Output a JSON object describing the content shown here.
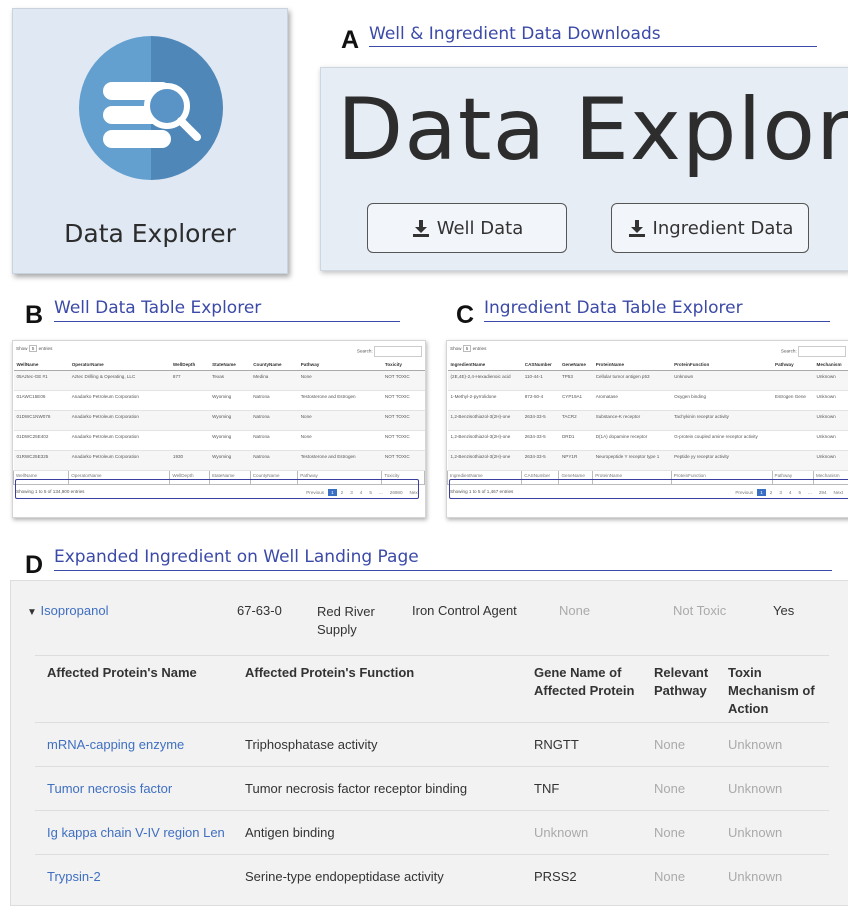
{
  "logo": {
    "icon": "database-search-icon",
    "label": "Data Explorer",
    "colors": {
      "light": "#64a0cf",
      "dark": "#4f87b8"
    }
  },
  "sections": {
    "a": {
      "letter": "A",
      "title": "Well & Ingredient Data Downloads"
    },
    "b": {
      "letter": "B",
      "title": "Well Data Table Explorer"
    },
    "c": {
      "letter": "C",
      "title": "Ingredient Data Table Explorer"
    },
    "d": {
      "letter": "D",
      "title": "Expanded Ingredient on Well Landing Page"
    }
  },
  "explorer": {
    "title": "Data Explorer",
    "well_button": "Well Data",
    "ingredient_button": "Ingredient Data"
  },
  "well_table": {
    "show_prefix": "Show",
    "show_value": "5",
    "show_suffix": "entries",
    "search_label": "Search:",
    "headers": [
      "WellName",
      "OperatorName",
      "WellDepth",
      "StateName",
      "CountyName",
      "Pathway",
      "Toxicity"
    ],
    "rows": [
      [
        "05Aztec-GE #1",
        "Aztec Drilling & Operating, LLC",
        "877",
        "Texas",
        "Medina",
        "None",
        "NOT TOXIC"
      ],
      [
        "01AWC15E06",
        "Anadarko Petroleum Corporation",
        "",
        "Wyoming",
        "Natrona",
        "Testosterone and Estrogen",
        "NOT TOXIC"
      ],
      [
        "01DWC1NW076",
        "Anadarko Petroleum Corporation",
        "",
        "Wyoming",
        "Natrona",
        "None",
        "NOT TOXIC"
      ],
      [
        "01DWC25E402",
        "Anadarko Petroleum Corporation",
        "",
        "Wyoming",
        "Natrona",
        "None",
        "NOT TOXIC"
      ],
      [
        "01RWC25E325",
        "Anadarko Petroleum Corporation",
        "1930",
        "Wyoming",
        "Natrona",
        "Testosterone and Estrogen",
        "NOT TOXIC"
      ]
    ],
    "footer": [
      "WellName",
      "OperatorName",
      "WellDepth",
      "StateName",
      "CountyName",
      "Pathway",
      "Toxicity"
    ],
    "info": "Showing 1 to 5 of 134,900 entries",
    "pages": [
      "Previous",
      "1",
      "2",
      "3",
      "4",
      "5",
      "...",
      "26980",
      "Next"
    ]
  },
  "ingredient_table": {
    "show_prefix": "Show",
    "show_value": "5",
    "show_suffix": "entries",
    "search_label": "Search:",
    "headers": [
      "IngredientName",
      "CASNumber",
      "GeneName",
      "ProteinName",
      "ProteinFunction",
      "Pathway",
      "Mechanism"
    ],
    "rows": [
      [
        "(2E,4E)-2,4-Hexadienoic acid",
        "110-44-1",
        "TP53",
        "Cellular tumor antigen p53",
        "Unknown",
        "",
        "Unknown"
      ],
      [
        "1-Methyl-2-pyrrolidone",
        "872-50-4",
        "CYP19A1",
        "Aromatase",
        "Oxygen binding",
        "Estrogen Gene",
        "Unknown"
      ],
      [
        "1,2-Benzisothiazol-3(2H)-one",
        "2634-33-5",
        "TACR2",
        "Substance-K receptor",
        "Tachykinin receptor activity",
        "",
        "Unknown"
      ],
      [
        "1,2-Benzisothiazol-3(2H)-one",
        "2634-33-5",
        "DRD1",
        "D(1A) dopamine receptor",
        "G-protein coupled amine receptor activity",
        "",
        "Unknown"
      ],
      [
        "1,2-Benzisothiazol-3(2H)-one",
        "2634-33-5",
        "NPY1R",
        "Neuropeptide Y receptor type 1",
        "Peptide yy receptor activity",
        "",
        "Unknown"
      ]
    ],
    "footer": [
      "IngredientName",
      "CASNumber",
      "GeneName",
      "ProteinName",
      "ProteinFunction",
      "Pathway",
      "Mechanism"
    ],
    "info": "Showing 1 to 5 of 1,467 entries",
    "pages": [
      "Previous",
      "1",
      "2",
      "3",
      "4",
      "5",
      "...",
      "294",
      "Next"
    ]
  },
  "landing": {
    "ingredient": {
      "name": "Isopropanol",
      "cas": "67-63-0",
      "supplier_line1": "Red River",
      "supplier_line2": "Supply",
      "purpose": "Iron Control Agent",
      "pathway": "None",
      "toxicity": "Not Toxic",
      "flag": "Yes"
    },
    "headers": {
      "protein_name": "Affected Protein's Name",
      "protein_function": "Affected Protein's Function",
      "gene_line1": "Gene Name of",
      "gene_line2": "Affected Protein",
      "pathway_line1": "Relevant",
      "pathway_line2": "Pathway",
      "mech_line1": "Toxin",
      "mech_line2": "Mechanism of",
      "mech_line3": "Action"
    },
    "rows": [
      {
        "name": "mRNA-capping enzyme",
        "function": "Triphosphatase activity",
        "gene": "RNGTT",
        "pathway": "None",
        "mechanism": "Unknown"
      },
      {
        "name": "Tumor necrosis factor",
        "function": "Tumor necrosis factor receptor binding",
        "gene": "TNF",
        "pathway": "None",
        "mechanism": "Unknown"
      },
      {
        "name": "Ig kappa chain V-IV region Len",
        "function": "Antigen binding",
        "gene": "Unknown",
        "pathway": "None",
        "mechanism": "Unknown"
      },
      {
        "name": "Trypsin-2",
        "function": "Serine-type endopeptidase activity",
        "gene": "PRSS2",
        "pathway": "None",
        "mechanism": "Unknown"
      }
    ]
  }
}
